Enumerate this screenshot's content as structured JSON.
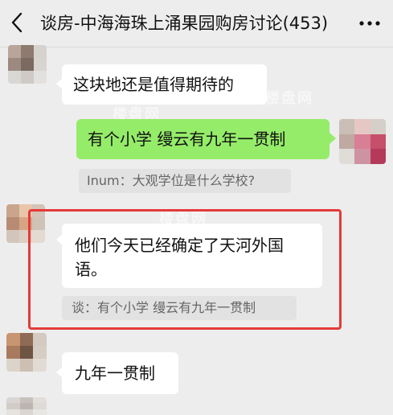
{
  "header": {
    "title": "谈房-中海海珠上涌果园购房讨论(453)"
  },
  "messages": [
    {
      "side": "left",
      "text": "这块地还是值得期待的"
    },
    {
      "side": "right",
      "text": "有个小学  缦云有九年一贯制"
    },
    {
      "quote": "Inum：大观学位是什么学校?"
    },
    {
      "side": "left",
      "text_line1": "他们今天已经确定了天河外国",
      "text_line2": "语。"
    },
    {
      "quote": "谈：有个小学  缦云有九年一贯制"
    },
    {
      "side": "left",
      "text": "九年一贯制"
    }
  ],
  "colors": {
    "background": "#ededed",
    "self_bubble": "#95ec69",
    "other_bubble": "#ffffff",
    "highlight_border": "#e53a3a"
  },
  "icons": {
    "back": "chevron-left-icon",
    "more": "more-dots-icon"
  }
}
